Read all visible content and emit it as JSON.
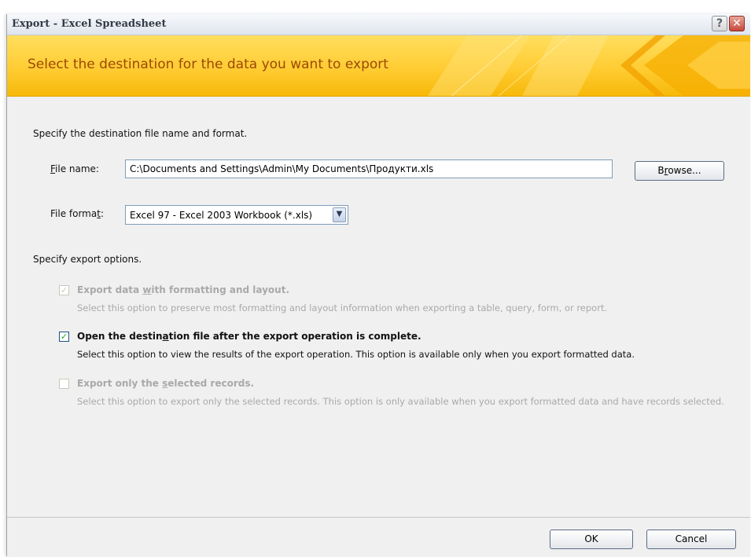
{
  "window": {
    "title": "Export - Excel Spreadsheet",
    "help_glyph": "?",
    "close_glyph": "✕"
  },
  "banner": {
    "title": "Select the destination for the data you want to export"
  },
  "destination": {
    "heading": "Specify the destination file name and format.",
    "file_name_label": {
      "mnemonic": "F",
      "rest": "ile name:"
    },
    "file_name_value": "C:\\Documents and Settings\\Admin\\My Documents\\Продукти.xls",
    "browse_button": {
      "before": "B",
      "mnemonic": "r",
      "rest": "owse..."
    },
    "file_format_label": {
      "before": "File forma",
      "mnemonic": "t",
      "rest": ":"
    },
    "file_format_value": "Excel 97 - Excel 2003 Workbook (*.xls)"
  },
  "export_options": {
    "heading": "Specify export options.",
    "options": [
      {
        "title_before": "Export data ",
        "title_mnemonic": "w",
        "title_after": "ith formatting and layout.",
        "description": "Select this option to preserve most formatting and layout information when exporting a table, query, form, or report.",
        "checked": true,
        "enabled": false
      },
      {
        "title_before": "Open the destin",
        "title_mnemonic": "a",
        "title_after": "tion file after the export operation is complete.",
        "description": "Select this option to view the results of the export operation. This option is available only when you export formatted data.",
        "checked": true,
        "enabled": true
      },
      {
        "title_before": "Export only the ",
        "title_mnemonic": "s",
        "title_after": "elected records.",
        "description": "Select this option to export only the selected records. This option is only available when you export formatted data and have records selected.",
        "checked": false,
        "enabled": false
      }
    ]
  },
  "footer": {
    "ok_label": "OK",
    "cancel_label": "Cancel"
  },
  "colors": {
    "banner_yellow": "#ffcc33",
    "banner_title": "#9c4a00",
    "checkmark_green": "#21a121",
    "disabled_text": "#a9a9a9"
  }
}
